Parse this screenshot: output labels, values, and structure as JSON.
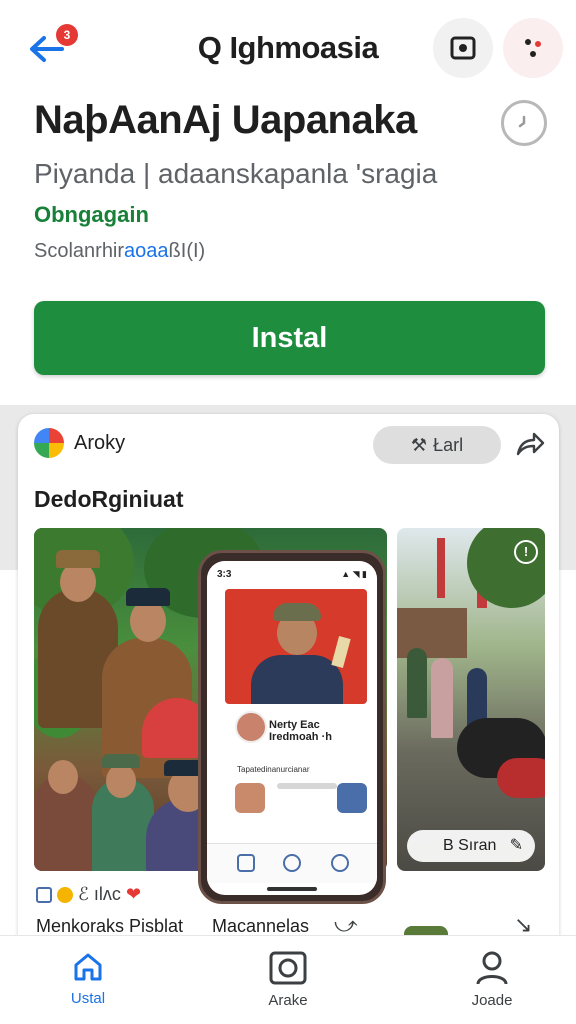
{
  "topbar": {
    "title": "Q Ighmoasia",
    "badge_count": "3"
  },
  "app": {
    "name": "NaþAanAj Uapanaka",
    "subtitle": "Piyanda | adaanskapanla 'sragia",
    "badge": "Obngagain",
    "meta_prefix": "Scolanrhir",
    "meta_highlight": "aoaa",
    "meta_suffix": "ßI(I)",
    "install_label": "Instal"
  },
  "card": {
    "author": "Aroky",
    "chip_label": "Łarl",
    "title": "DedoRginiuat",
    "side_pill_label": "B Sıran",
    "phone": {
      "time": "3:3",
      "hero_caption": "Nerty Eac Iredmoah ·h",
      "row_label": "Tapatedinanurcianar"
    },
    "row_icons_text": "ℰ ılʌc",
    "row_left": "Menkoraks Pisblat",
    "row_mid": "Macannelas",
    "row_right_arrow": "↘"
  },
  "bottom_nav": [
    {
      "label": "Ustal",
      "icon": "home-icon",
      "active": true
    },
    {
      "label": "Arake",
      "icon": "camera-icon",
      "active": false
    },
    {
      "label": "Joade",
      "icon": "person-icon",
      "active": false
    }
  ],
  "colors": {
    "install_green": "#1e8e3e",
    "accent_blue": "#1a73e8",
    "badge_green": "#188038",
    "notif_red": "#e53935"
  }
}
